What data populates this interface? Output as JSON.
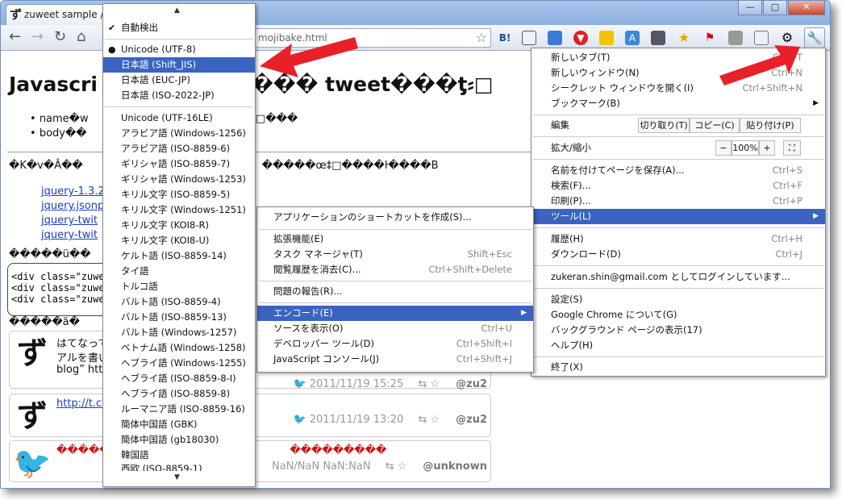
{
  "tab": {
    "favicon": "ず",
    "title": "zuweet sample /"
  },
  "window_controls": {
    "minimize": "—",
    "maximize": "▢",
    "close": "✕"
  },
  "toolbar": {
    "url": "mojibake.html"
  },
  "page": {
    "heading_left": "Javascri",
    "heading_right": "��� tweet���ƫ⸗□",
    "bullet1": "name�w",
    "bullet1_r": "�□���",
    "bullet2": "body��",
    "garbled_line": "�K�v�Â��",
    "garbled_line_r": "�����œ‡□����ŀ����B",
    "links": [
      "jquery-1.3.2",
      "jquery.jsonp",
      "jquery-twit",
      "jquery-twit"
    ],
    "garbled_line2": "�����ü��",
    "code_lines": [
      "<div class=\"zuwe",
      "<div class=\"zuwe",
      "<div class=\"zuwe"
    ],
    "garbled_line3": "�����ä�",
    "tweet1_text1": "はてなって",
    "tweet1_text2": "アルを書い",
    "tweet1_text3": "blog” http",
    "tweet1_meta_time": "2011/11/19 15:25",
    "tweet1_meta_user": "@zu2",
    "tweet2_link": "http://t.co",
    "tweet2_meta_time": "2011/11/19 13:20",
    "tweet2_meta_user": "@zu2",
    "tweet3_red": "�������",
    "tweet3_red_r": "���������",
    "tweet3_meta_time": "NaN/NaN NaN:NaN",
    "tweet3_meta_user": "@unknown"
  },
  "encoding_menu": {
    "auto_detect": "自動検出",
    "items": [
      "Unicode (UTF-8)",
      "日本語 (Shift_JIS)",
      "日本語 (EUC-JP)",
      "日本語 (ISO-2022-JP)",
      "Unicode (UTF-16LE)",
      "アラビア語 (Windows-1256)",
      "アラビア語 (ISO-8859-6)",
      "ギリシャ語 (ISO-8859-7)",
      "ギリシャ語 (Windows-1253)",
      "キリル文字 (ISO-8859-5)",
      "キリル文字 (Windows-1251)",
      "キリル文字 (KOI8-R)",
      "キリル文字 (KOI8-U)",
      "ケルト語 (ISO-8859-14)",
      "タイ語",
      "トルコ語",
      "バルト語 (ISO-8859-4)",
      "バルト語 (ISO-8859-13)",
      "バルト語 (Windows-1257)",
      "ベトナム語 (Windows-1258)",
      "ヘブライ語 (Windows-1255)",
      "ヘブライ語 (ISO-8859-8-I)",
      "ヘブライ語 (ISO-8859-8)",
      "ルーマニア語 (ISO-8859-16)",
      "簡体中国語 (GBK)",
      "簡体中国語 (gb18030)",
      "韓国語",
      "西欧 (ISO-8859-1)"
    ],
    "selected": "日本語 (Shift_JIS)"
  },
  "tools_menu": {
    "items": [
      {
        "label": "アプリケーションのショートカットを作成(S)...",
        "shortcut": ""
      },
      {
        "label": "拡張機能(E)",
        "shortcut": ""
      },
      {
        "label": "タスク マネージャ(T)",
        "shortcut": "Shift+Esc"
      },
      {
        "label": "閲覧履歴を消去(C)...",
        "shortcut": "Ctrl+Shift+Delete"
      },
      {
        "label": "問題の報告(R)...",
        "shortcut": ""
      },
      {
        "label": "エンコード(E)",
        "shortcut": ""
      },
      {
        "label": "ソースを表示(O)",
        "shortcut": "Ctrl+U"
      },
      {
        "label": "デベロッパー ツール(D)",
        "shortcut": "Ctrl+Shift+I"
      },
      {
        "label": "JavaScript コンソール(J)",
        "shortcut": "Ctrl+Shift+J"
      }
    ]
  },
  "main_menu": {
    "new_tab": "新しいタブ(T)",
    "new_tab_sc": "Ctrl+T",
    "new_window": "新しいウィンドウ(N)",
    "new_window_sc": "Ctrl+N",
    "incognito": "シークレット ウィンドウを開く(I)",
    "incognito_sc": "Ctrl+Shift+N",
    "bookmarks": "ブックマーク(B)",
    "edit": "編集",
    "cut": "切り取り(T)",
    "copy": "コピー(C)",
    "paste": "貼り付け(P)",
    "zoom": "拡大/縮小",
    "zoom_minus": "−",
    "zoom_value": "100%",
    "zoom_plus": "+",
    "save_page": "名前を付けてページを保存(A)...",
    "save_page_sc": "Ctrl+S",
    "find": "検索(F)...",
    "find_sc": "Ctrl+F",
    "print": "印刷(P)...",
    "print_sc": "Ctrl+P",
    "tools": "ツール(L)",
    "history": "履歴(H)",
    "history_sc": "Ctrl+H",
    "downloads": "ダウンロード(D)",
    "downloads_sc": "Ctrl+J",
    "signed_in": "zukeran.shin@gmail.com としてログインしています...",
    "settings": "設定(S)",
    "about": "Google Chrome について(G)",
    "background": "バックグラウンド ページの表示(17)",
    "help": "ヘルプ(H)",
    "exit": "終了(X)"
  },
  "colors": {
    "highlight": "#3a64c0",
    "arrow": "#e8202a",
    "garbled_red": "#d01010"
  }
}
